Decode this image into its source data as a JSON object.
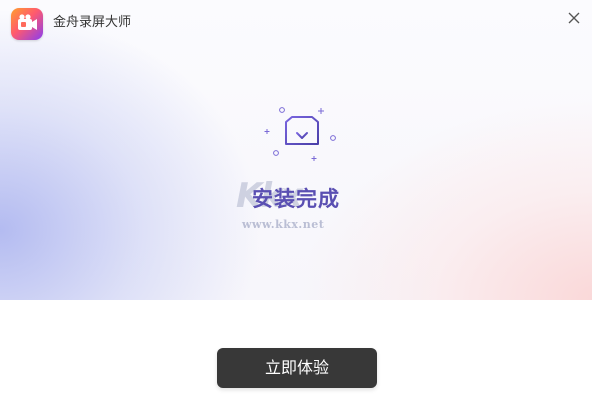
{
  "window": {
    "app_title": "金舟录屏大师",
    "close_icon": "close-icon"
  },
  "install": {
    "icon": "box-download-icon",
    "status_text": "安装完成"
  },
  "watermark": {
    "logo_text": "Kkx",
    "url_text": "www.kkx.net"
  },
  "actions": {
    "primary_label": "立即体验"
  },
  "colors": {
    "accent": "#5a4fb2",
    "button_bg": "#383838",
    "button_text": "#ffffff"
  }
}
